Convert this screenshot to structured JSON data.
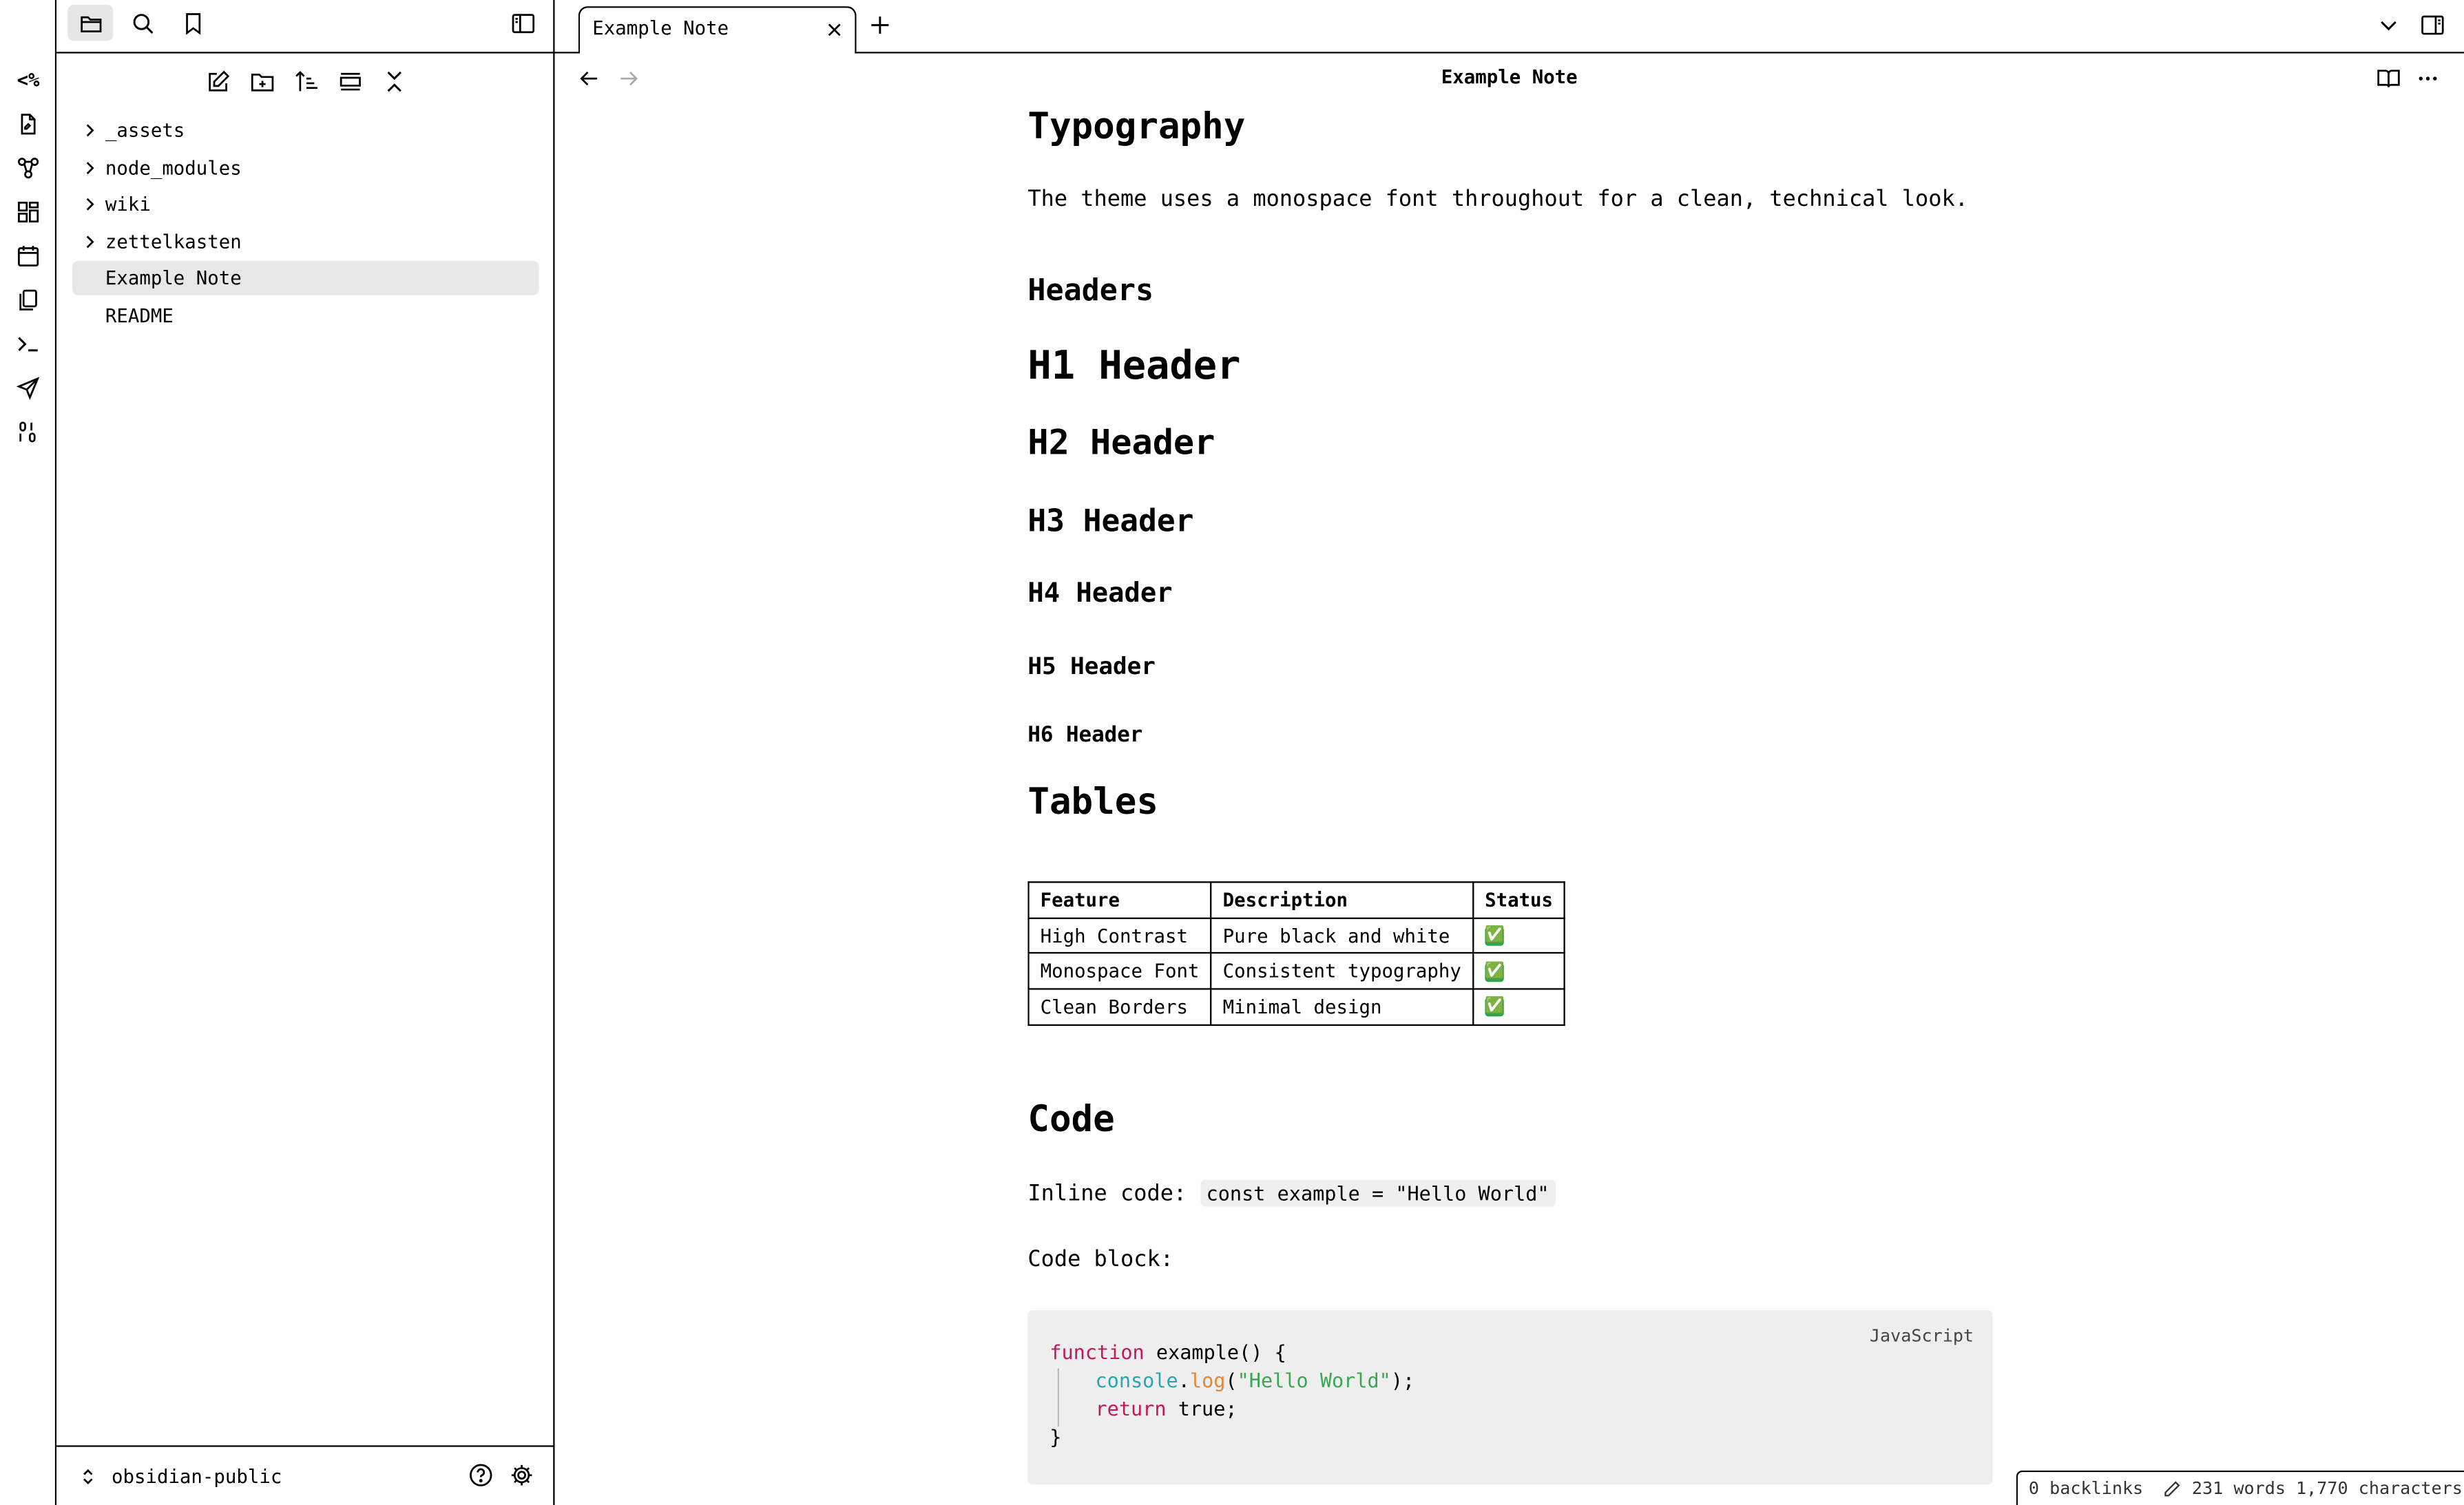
{
  "ribbon": {
    "items": [
      "templater-icon",
      "new-note-icon",
      "graph-icon",
      "canvas-icon",
      "calendar-icon",
      "pages-icon",
      "terminal-icon",
      "send-icon",
      "binary-icon"
    ],
    "templater_label": "<%"
  },
  "sidebar": {
    "tabs": [
      "files-icon",
      "search-icon",
      "bookmark-icon"
    ],
    "actions": [
      "new-note",
      "new-folder",
      "change-sort-order",
      "auto-reveal",
      "collapse-all"
    ],
    "files": [
      {
        "label": "_assets",
        "type": "folder"
      },
      {
        "label": "node_modules",
        "type": "folder"
      },
      {
        "label": "wiki",
        "type": "folder"
      },
      {
        "label": "zettelkasten",
        "type": "folder"
      },
      {
        "label": "Example Note",
        "type": "file",
        "active": true
      },
      {
        "label": "README",
        "type": "file"
      }
    ],
    "vault_name": "obsidian-public"
  },
  "tabs": [
    {
      "label": "Example Note",
      "active": true
    }
  ],
  "view": {
    "title": "Example Note"
  },
  "note": {
    "typography_heading": "Typography",
    "typography_text": "The theme uses a monospace font throughout for a clean, technical look.",
    "headers_heading": "Headers",
    "h1": "H1 Header",
    "h2": "H2 Header",
    "h3": "H3 Header",
    "h4": "H4 Header",
    "h5": "H5 Header",
    "h6": "H6 Header",
    "tables_heading": "Tables",
    "table": {
      "headers": [
        "Feature",
        "Description",
        "Status"
      ],
      "rows": [
        [
          "High Contrast",
          "Pure black and white",
          "✅"
        ],
        [
          "Monospace Font",
          "Consistent typography",
          "✅"
        ],
        [
          "Clean Borders",
          "Minimal design",
          "✅"
        ]
      ]
    },
    "code_heading": "Code",
    "inline_label": "Inline code:",
    "inline_code": "const example = \"Hello World\"",
    "block_label": "Code block:",
    "code_lang": "JavaScript",
    "code": {
      "l1_kw": "function",
      "l1_rest": " example() {",
      "l2_obj": "console",
      "l2_dot": ".",
      "l2_fn": "log",
      "l2_open": "(",
      "l2_str": "\"Hello World\"",
      "l2_close": ");",
      "l3_kw": "return",
      "l3_rest": " true;",
      "l4": "}"
    }
  },
  "status": {
    "backlinks": "0 backlinks",
    "counts": "231 words 1,770 characters"
  },
  "colors": {
    "accent": "#000000",
    "active_bg": "#e8e8e8",
    "code_bg": "#eeeeee",
    "keyword": "#c2185b",
    "string": "#3aa655"
  }
}
